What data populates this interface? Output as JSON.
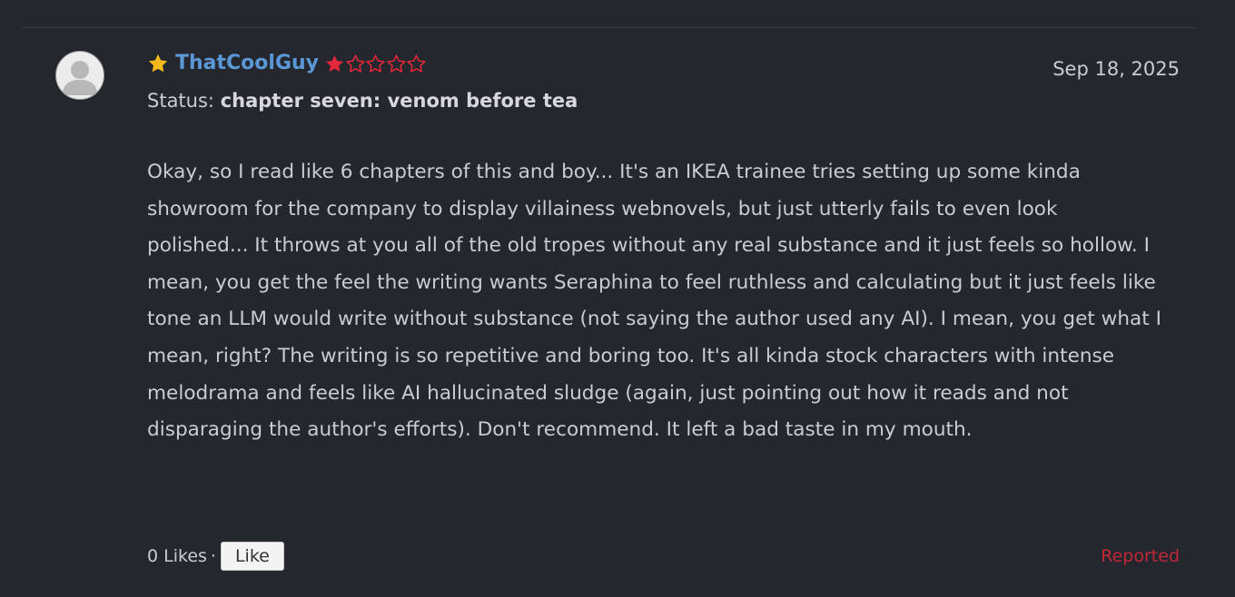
{
  "review": {
    "username": "ThatCoolGuy",
    "rating": 1,
    "rating_max": 5,
    "status_label": "Status:",
    "status_value": "chapter seven: venom before tea",
    "date": "Sep 18, 2025",
    "body": "Okay, so I read like 6 chapters of this and boy... It's an IKEA trainee tries setting up some kinda showroom for the company to display villainess webnovels, but just utterly fails to even look polished... It throws at you all of the old tropes without any real substance and it just feels so hollow. I mean, you get the feel the writing wants Seraphina to feel ruthless and calculating but it just feels like tone an LLM would write without substance (not saying the author used any AI). I mean, you get what I mean, right? The writing is so repetitive and boring too. It's all kinda stock characters with intense melodrama and feels like AI hallucinated sludge (again, just pointing out how it reads and not disparaging the author's efforts). Don't recommend. It left a bad taste in my mouth."
  },
  "footer": {
    "likes": "0 Likes",
    "separator": "·",
    "like_button": "Like",
    "reported": "Reported"
  },
  "colors": {
    "background": "#24272d",
    "username": "#5b97d5",
    "star_filled": "#e5273c",
    "badge_star": "#f5b91b",
    "reported": "#c0283a"
  },
  "icons": {
    "avatar": "user-avatar-icon",
    "badge": "star-badge-icon",
    "rating": "star-icon"
  }
}
